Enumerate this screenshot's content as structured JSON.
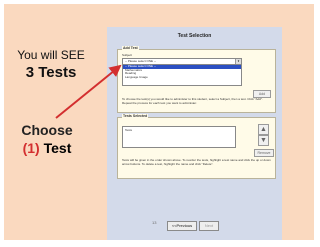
{
  "callouts": {
    "you_will_see": "You will SEE",
    "three_tests": "3 Tests",
    "choose": "Choose",
    "number": "(1)",
    "test": "Test"
  },
  "page": {
    "title": "Test Selection",
    "add_test": {
      "legend": "Add Test",
      "subject_label": "Subject",
      "select_value": "-- Please select ONE --",
      "options": [
        "-- Please select ONE --",
        "Mathematics",
        "Reading",
        "Language Usage"
      ],
      "selected_index": 0,
      "add_button": "Add",
      "instructions": "To choose the test(s) you would like to administer to this student, select a Subject, then a test. Click \"Add\". Repeat the process for each test you want to administer."
    },
    "tests_selected": {
      "legend": "Tests Selected",
      "list_header": "Tests",
      "up_icon": "arrow-up-icon",
      "down_icon": "arrow-down-icon",
      "remove_button": "Remove",
      "instructions": "Tests will be given in the order shown above. To reorder the tests, highlight a test name and click the up or down arrow buttons. To delete a test, highlight the name and click \"Delete\"."
    },
    "previous_button": "<<Previous",
    "next_button": "Next"
  },
  "slide_number": "13",
  "colors": {
    "slide_bg": "#fad9bf",
    "page_bg": "#d3daea",
    "panel_bg": "#fffbe8",
    "arrow": "#d32f2f",
    "selected_row": "#2b4fc2"
  }
}
